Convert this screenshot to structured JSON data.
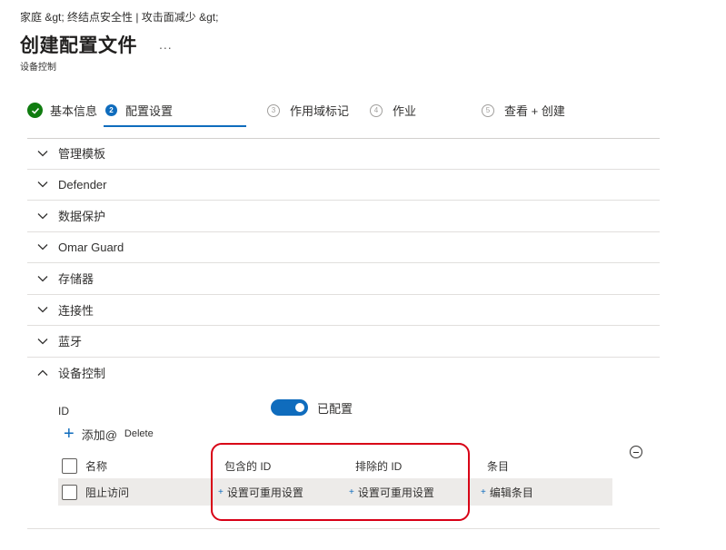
{
  "breadcrumb": "家庭 &gt;  终结点安全性 | 攻击面减少  &gt;",
  "header": {
    "title": "创建配置文件",
    "more": "...",
    "subtitle": "设备控制"
  },
  "steps": [
    {
      "num": "",
      "label": "基本信息",
      "state": "done"
    },
    {
      "num": "2",
      "label": "配置设置",
      "state": "active"
    },
    {
      "num": "3",
      "label": "作用域标记",
      "state": "pending"
    },
    {
      "num": "4",
      "label": "作业",
      "state": "pending"
    },
    {
      "num": "5",
      "label": "查看 + 创建",
      "state": "pending"
    }
  ],
  "sections": [
    {
      "label": "管理模板"
    },
    {
      "label": "Defender"
    },
    {
      "label": "数据保护"
    },
    {
      "label": "Omar Guard"
    },
    {
      "label": "存储器"
    },
    {
      "label": "连接性"
    },
    {
      "label": "蓝牙"
    },
    {
      "label": "设备控制"
    }
  ],
  "device_control": {
    "id_label": "ID",
    "toggle_label": "已配置",
    "toggle_on": true,
    "add_label": "添加@",
    "delete_label": "Delete",
    "columns": [
      "名称",
      "包含的 ID",
      "排除的 ID",
      "条目"
    ],
    "rows": [
      {
        "name": "阻止访问",
        "included": "设置可重用设置",
        "excluded": "设置可重用设置",
        "entries": "编辑条目"
      }
    ]
  },
  "colors": {
    "accent": "#0f6cbd",
    "success": "#107c10",
    "highlight": "#d80016"
  }
}
